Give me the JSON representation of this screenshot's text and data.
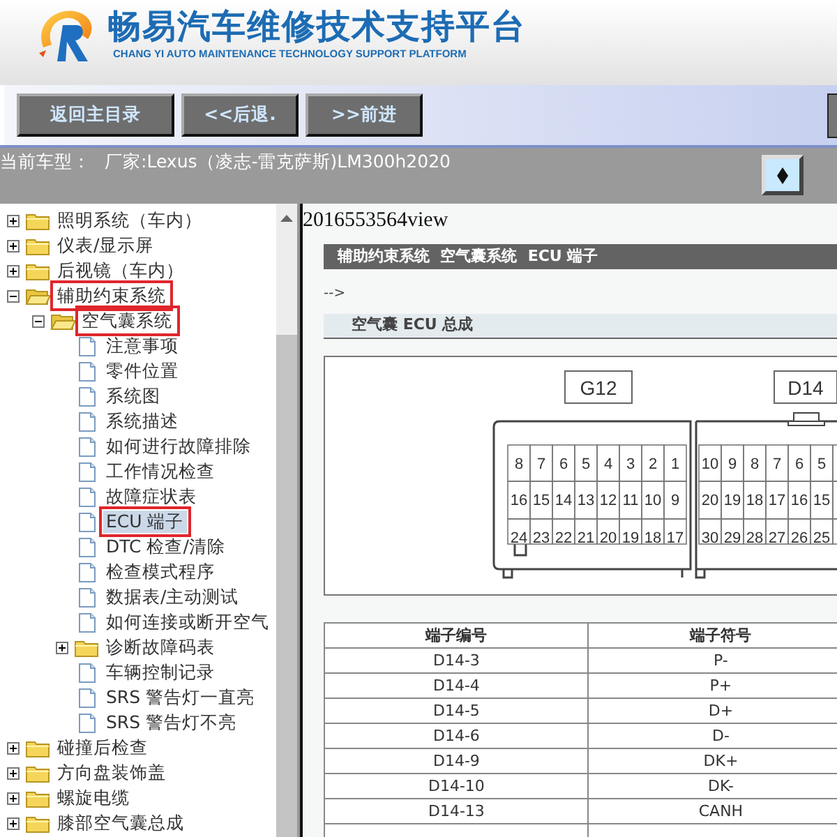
{
  "header": {
    "title": "畅易汽车维修技术支持平台",
    "subtitle": "CHANG YI AUTO MAINTENANCE TECHNOLOGY SUPPORT PLATFORM"
  },
  "toolbar": {
    "buttons": [
      "返回主目录",
      "<<后退.",
      ">>前进"
    ]
  },
  "vehicle": {
    "label": "当前车型：",
    "value": "厂家:Lexus（凌志-雷克萨斯)LM300h2020"
  },
  "tree": [
    {
      "label": "照明系统（车内）",
      "kind": "folder",
      "expanded": false,
      "selected": false,
      "annotated": false
    },
    {
      "label": "仪表/显示屏",
      "kind": "folder",
      "expanded": false,
      "selected": false,
      "annotated": false
    },
    {
      "label": "后视镜（车内）",
      "kind": "folder",
      "expanded": false,
      "selected": false,
      "annotated": false
    },
    {
      "label": "辅助约束系统",
      "kind": "folder",
      "expanded": true,
      "selected": false,
      "annotated": true,
      "children": [
        {
          "label": "空气囊系统",
          "kind": "folder",
          "expanded": true,
          "selected": false,
          "annotated": true,
          "children": [
            {
              "label": "注意事项",
              "kind": "doc",
              "selected": false,
              "annotated": false
            },
            {
              "label": "零件位置",
              "kind": "doc",
              "selected": false,
              "annotated": false
            },
            {
              "label": "系统图",
              "kind": "doc",
              "selected": false,
              "annotated": false
            },
            {
              "label": "系统描述",
              "kind": "doc",
              "selected": false,
              "annotated": false
            },
            {
              "label": "如何进行故障排除",
              "kind": "doc",
              "selected": false,
              "annotated": false
            },
            {
              "label": "工作情况检查",
              "kind": "doc",
              "selected": false,
              "annotated": false
            },
            {
              "label": "故障症状表",
              "kind": "doc",
              "selected": false,
              "annotated": false
            },
            {
              "label": "ECU 端子",
              "kind": "doc",
              "selected": true,
              "annotated": true
            },
            {
              "label": "DTC 检查/清除",
              "kind": "doc",
              "selected": false,
              "annotated": false
            },
            {
              "label": "检查模式程序",
              "kind": "doc",
              "selected": false,
              "annotated": false
            },
            {
              "label": "数据表/主动测试",
              "kind": "doc",
              "selected": false,
              "annotated": false
            },
            {
              "label": "如何连接或断开空气",
              "kind": "doc",
              "selected": false,
              "annotated": false
            },
            {
              "label": "诊断故障码表",
              "kind": "folder",
              "expanded": false,
              "selected": false,
              "annotated": false
            },
            {
              "label": "车辆控制记录",
              "kind": "doc",
              "selected": false,
              "annotated": false
            },
            {
              "label": "SRS 警告灯一直亮",
              "kind": "doc",
              "selected": false,
              "annotated": false
            },
            {
              "label": "SRS 警告灯不亮",
              "kind": "doc",
              "selected": false,
              "annotated": false
            }
          ]
        }
      ]
    },
    {
      "label": "碰撞后检查",
      "kind": "folder",
      "expanded": false,
      "selected": false,
      "annotated": false
    },
    {
      "label": "方向盘装饰盖",
      "kind": "folder",
      "expanded": false,
      "selected": false,
      "annotated": false
    },
    {
      "label": "螺旋电缆",
      "kind": "folder",
      "expanded": false,
      "selected": false,
      "annotated": false
    },
    {
      "label": "膝部空气囊总成",
      "kind": "folder",
      "expanded": false,
      "selected": false,
      "annotated": false
    }
  ],
  "content": {
    "page_id": "2016553564view",
    "breadcrumb": "辅助约束系统  空气囊系统  ECU 端子",
    "comment": "-->",
    "section": "空气囊 ECU 总成",
    "connectors": [
      {
        "label": "G12",
        "rows": [
          [
            "8",
            "7",
            "6",
            "5",
            "4",
            "3",
            "2",
            "1"
          ],
          [
            "16",
            "15",
            "14",
            "13",
            "12",
            "11",
            "10",
            "9"
          ],
          [
            "24",
            "23",
            "22",
            "21",
            "20",
            "19",
            "18",
            "17"
          ]
        ]
      },
      {
        "label": "D14",
        "rows": [
          [
            "10",
            "9",
            "8",
            "7",
            "6",
            "5"
          ],
          [
            "20",
            "19",
            "18",
            "17",
            "16",
            "15"
          ],
          [
            "30",
            "29",
            "28",
            "27",
            "26",
            "25"
          ]
        ]
      }
    ],
    "table": {
      "columns": [
        "端子编号",
        "端子符号"
      ],
      "rows": [
        [
          "D14-3",
          "P-"
        ],
        [
          "D14-4",
          "P+"
        ],
        [
          "D14-5",
          "D+"
        ],
        [
          "D14-6",
          "D-"
        ],
        [
          "D14-9",
          "DK+"
        ],
        [
          "D14-10",
          "DK-"
        ],
        [
          "D14-13",
          "CANH"
        ]
      ]
    }
  }
}
